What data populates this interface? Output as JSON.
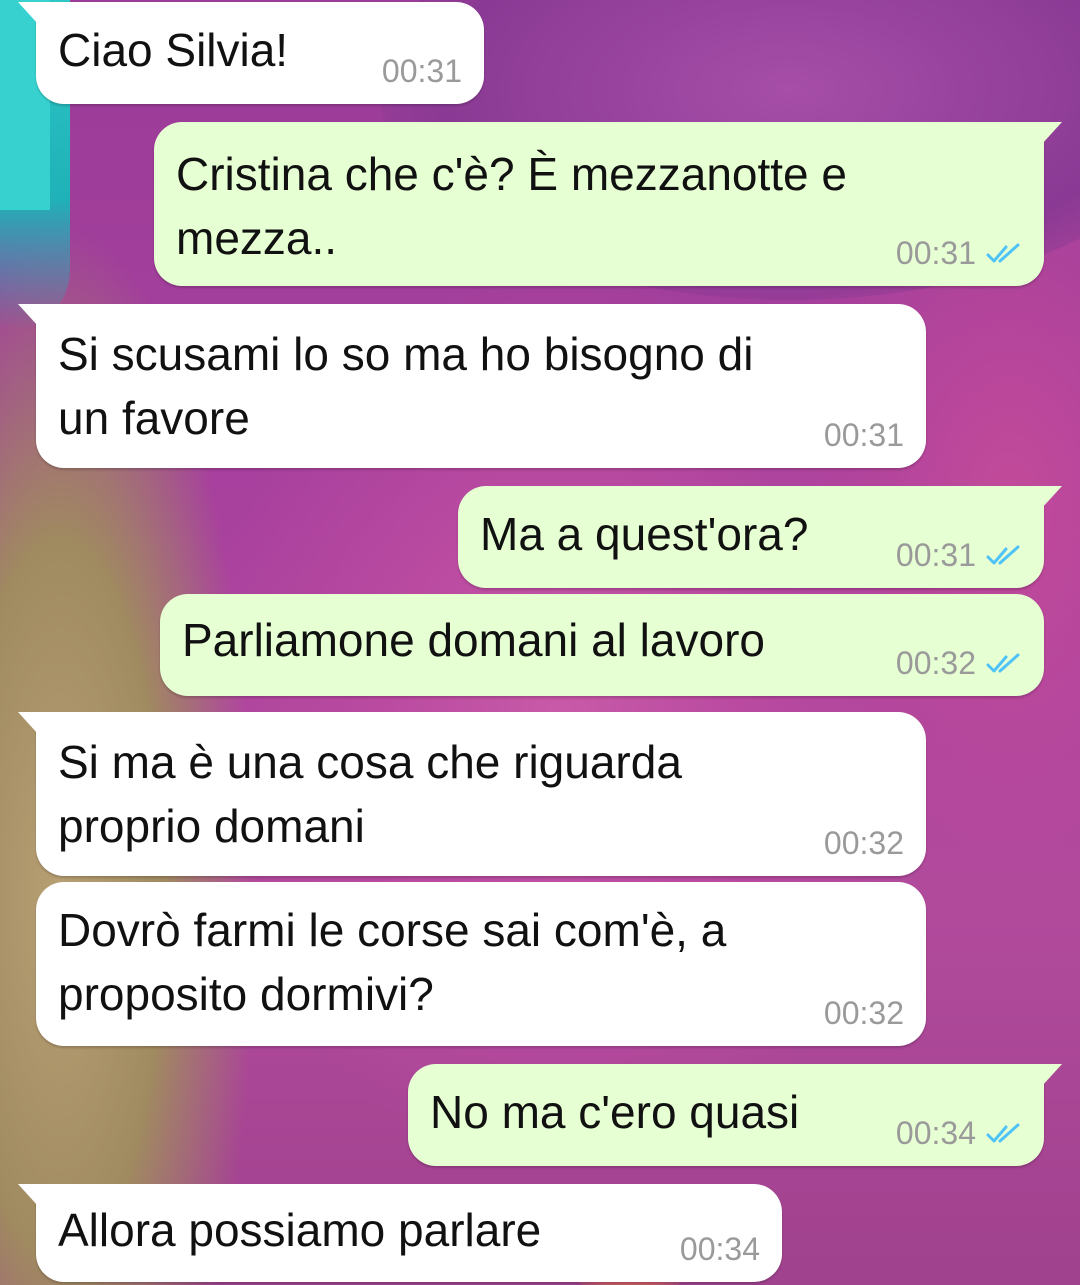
{
  "messages": [
    {
      "direction": "in",
      "text": "Ciao Silvia!",
      "time": "00:31"
    },
    {
      "direction": "out",
      "text": "Cristina che c'è? È mezzanotte e\nmezza..",
      "time": "00:31",
      "status": "read"
    },
    {
      "direction": "in",
      "text": "Si scusami lo so ma ho bisogno di\nun favore",
      "time": "00:31"
    },
    {
      "direction": "out",
      "text": "Ma a quest'ora?",
      "time": "00:31",
      "status": "read"
    },
    {
      "direction": "out",
      "text": "Parliamone domani al lavoro",
      "time": "00:32",
      "status": "read"
    },
    {
      "direction": "in",
      "text": "Si ma è una cosa che riguarda\nproprio domani",
      "time": "00:32"
    },
    {
      "direction": "in",
      "text": "Dovrò farmi le corse sai com'è, a\nproposito dormivi?",
      "time": "00:32"
    },
    {
      "direction": "out",
      "text": "No ma c'ero quasi",
      "time": "00:34",
      "status": "read"
    },
    {
      "direction": "in",
      "text": "Allora possiamo parlare",
      "time": "00:34"
    }
  ],
  "colors": {
    "incoming_bubble": "#ffffff",
    "outgoing_bubble": "#e6ffd3",
    "read_ticks": "#4fc3f7",
    "timestamp": "#9a9a9a"
  },
  "icons": {
    "read_status": "double-check-icon"
  }
}
